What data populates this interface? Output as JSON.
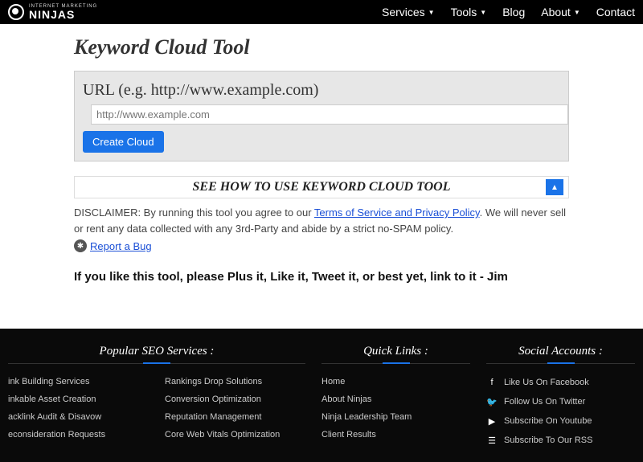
{
  "logo": {
    "small": "INTERNET MARKETING",
    "big": "NINJAS"
  },
  "nav": {
    "services": "Services",
    "tools": "Tools",
    "blog": "Blog",
    "about": "About",
    "contact": "Contact"
  },
  "page": {
    "title": "Keyword Cloud Tool"
  },
  "form": {
    "url_label": "URL (e.g. http://www.example.com)",
    "url_placeholder": "http://www.example.com",
    "submit": "Create Cloud"
  },
  "howto": {
    "title": "SEE HOW TO USE KEYWORD CLOUD TOOL"
  },
  "disclaimer": {
    "prefix": "DISCLAIMER: By running this tool you agree to our ",
    "link": "Terms of Service and Privacy Policy",
    "suffix": ". We will never sell or rent any data collected with any 3rd-Party and abide by a strict no-SPAM policy."
  },
  "bug": {
    "label": "Report a Bug"
  },
  "share": {
    "text": "If you like this tool, please Plus it, Like it, Tweet it, or best yet, link to it - Jim"
  },
  "footer": {
    "seo_h": "Popular SEO Services :",
    "seo_col1": [
      "ink Building Services",
      "inkable Asset Creation",
      "acklink Audit & Disavow",
      "econsideration Requests"
    ],
    "seo_col2": [
      "Rankings Drop Solutions",
      "Conversion Optimization",
      "Reputation Management",
      "Core Web Vitals Optimization"
    ],
    "quick_h": "Quick Links :",
    "quick": [
      "Home",
      "About Ninjas",
      "Ninja Leadership Team",
      "Client Results"
    ],
    "social_h": "Social Accounts :",
    "social": [
      {
        "icon": "facebook-icon",
        "glyph": "f",
        "label": "Like Us On Facebook"
      },
      {
        "icon": "twitter-icon",
        "glyph": "🐦",
        "label": "Follow Us On Twitter"
      },
      {
        "icon": "youtube-icon",
        "glyph": "▶",
        "label": "Subscribe On Youtube"
      },
      {
        "icon": "rss-icon",
        "glyph": "☰",
        "label": "Subscribe To Our RSS"
      }
    ]
  }
}
